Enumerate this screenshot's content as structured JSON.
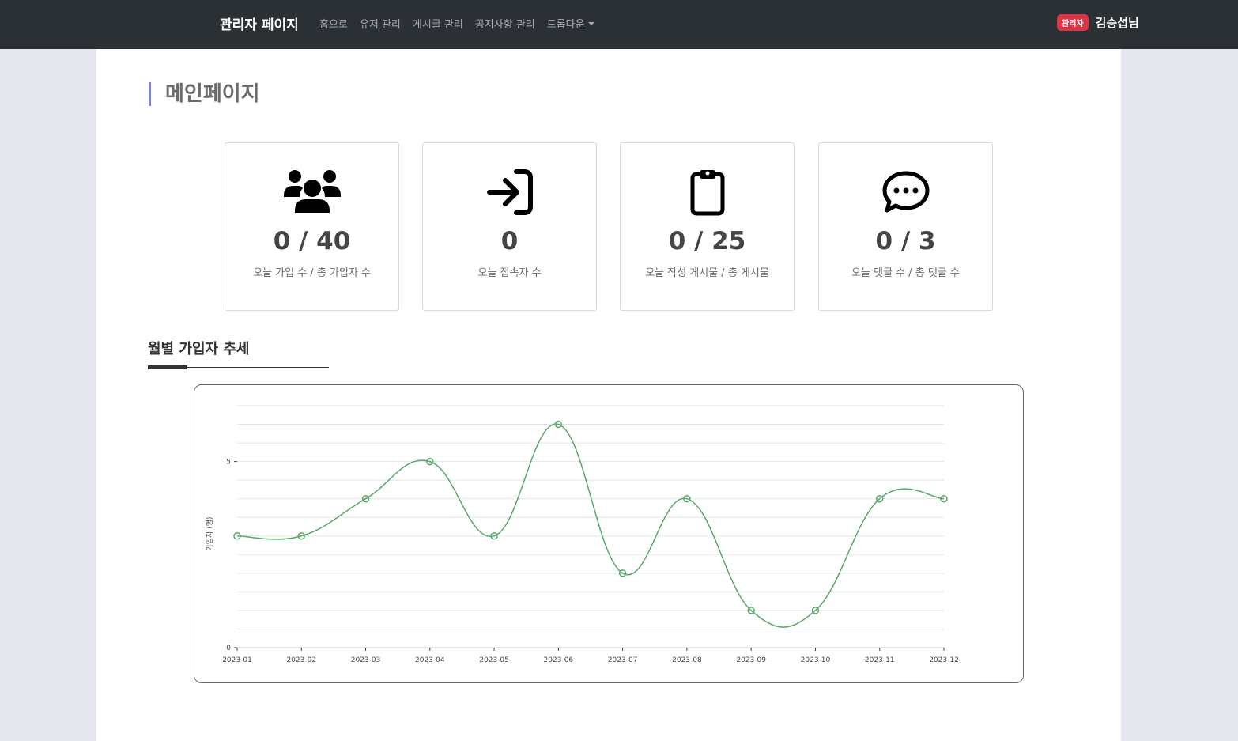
{
  "navbar": {
    "brand": "관리자 페이지",
    "links": [
      "홈으로",
      "유저 관리",
      "게시글 관리",
      "공지사항 관리"
    ],
    "dropdown": "드롭다운",
    "badge": "관리자",
    "user": "김승섭님"
  },
  "page": {
    "title": "메인페이지"
  },
  "stats": [
    {
      "icon": "users-icon",
      "value": "0 / 40",
      "label": "오늘 가입 수 / 총 가입자 수"
    },
    {
      "icon": "sign-in-icon",
      "value": "0",
      "label": "오늘 접속자 수"
    },
    {
      "icon": "clipboard-icon",
      "value": "0 / 25",
      "label": "오늘 작성 게시물 / 총 게시물"
    },
    {
      "icon": "comment-dots-icon",
      "value": "0 / 3",
      "label": "오늘 댓글 수 / 총 댓글 수"
    }
  ],
  "section": {
    "title": "월별 가입자 추세"
  },
  "colors": {
    "line": "#5aa86a",
    "navbar": "#2b3035",
    "badge": "#dc3545",
    "title_accent": "#7c83c8"
  },
  "chart_data": {
    "type": "line",
    "x": [
      "2023-01",
      "2023-02",
      "2023-03",
      "2023-04",
      "2023-05",
      "2023-06",
      "2023-07",
      "2023-08",
      "2023-09",
      "2023-10",
      "2023-11",
      "2023-12"
    ],
    "values": [
      3,
      3,
      4,
      5,
      3,
      6,
      2,
      4,
      1,
      1,
      4,
      4
    ],
    "ylabel": "가입자 (명)",
    "y_ticks": [
      0,
      5
    ],
    "ylim": [
      0,
      6.5
    ],
    "smooth": true,
    "grid": true
  }
}
